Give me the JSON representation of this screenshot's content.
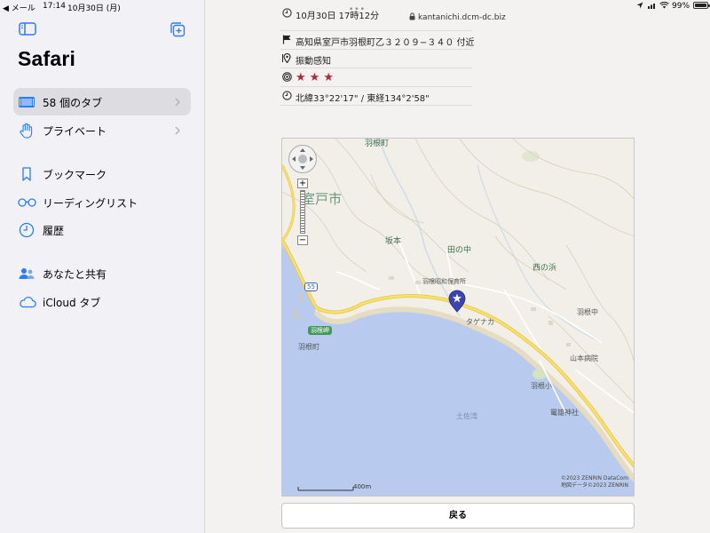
{
  "status_bar": {
    "back_app": "◀ メール",
    "time": "17:14",
    "date": "10月30日 (月)",
    "battery": "99%",
    "battery_level": 0.99
  },
  "sidebar": {
    "title": "Safari",
    "items": [
      {
        "label": "58 個のタブ",
        "selected": true,
        "icon": "tabs-icon"
      },
      {
        "label": "プライベート",
        "icon": "hand-icon"
      },
      {
        "label": "ブックマーク",
        "icon": "bookmark-icon"
      },
      {
        "label": "リーディングリスト",
        "icon": "glasses-icon"
      },
      {
        "label": "履歴",
        "icon": "clock-icon"
      },
      {
        "label": "あなたと共有",
        "icon": "shared-with-you-icon"
      },
      {
        "label": "iCloud タブ",
        "icon": "cloud-icon"
      }
    ]
  },
  "browser": {
    "url": "kantanichi.dcm-dc.biz"
  },
  "quake_info": {
    "rows": [
      {
        "icon": "clock-icon",
        "text": "10月30日 17時12分"
      },
      {
        "icon": "flag-icon",
        "text": "高知県室戸市羽根町乙３２０９−３４０ 付近"
      },
      {
        "icon": "pin-icon",
        "text": "振動感知"
      },
      {
        "icon": "signal-icon",
        "stars": 3,
        "star_glyph": "★"
      },
      {
        "icon": "clock-icon",
        "text": "北緯33°22'17\" / 東経134°2'58\""
      }
    ]
  },
  "map": {
    "labels": {
      "hane_top": "羽根町",
      "muroto": "室戸市",
      "sakamoto": "坂本",
      "tanonaka": "田の中",
      "nishinohama": "西の浜",
      "nursery": "羽根昭和保育所",
      "hane_jhs": "羽根中",
      "tagenaka": "タゲナカ",
      "cape": "羽根岬",
      "hanecho": "羽根町",
      "route": "55",
      "hospital": "山本病院",
      "hane_es": "羽根小",
      "shrine": "竃雄神社",
      "tosawan": "土佐湾"
    },
    "copyright": "©2023 ZENRIN DataCom",
    "copyright2": "地図データ©2023 ZENRIN",
    "scale": "400m",
    "zoom_in": "+",
    "zoom_out": "−"
  },
  "back_button": "戻る"
}
